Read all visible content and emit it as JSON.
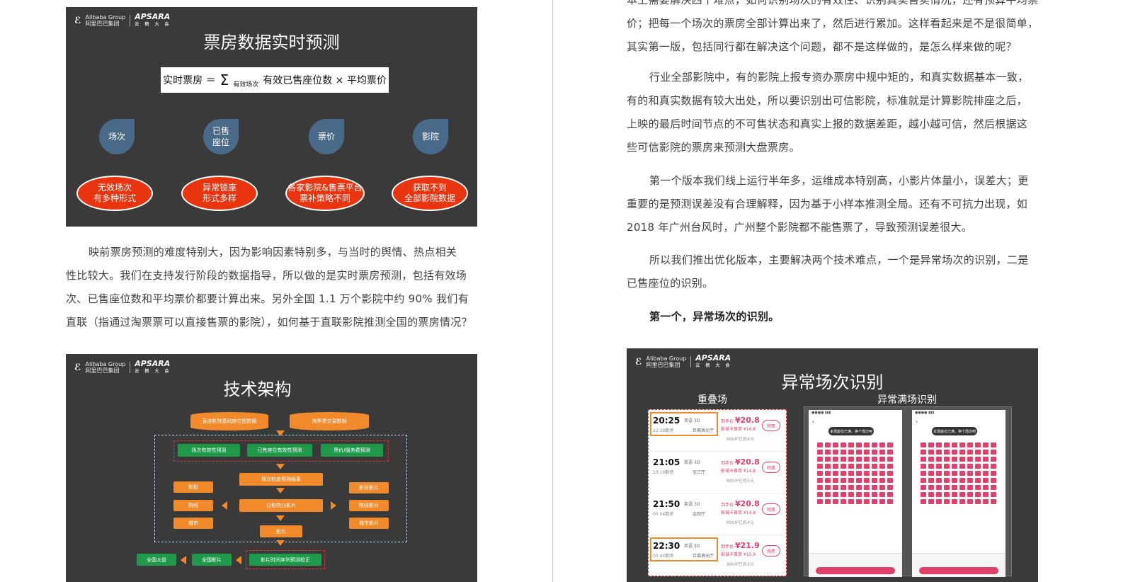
{
  "left_page": {
    "slide1": {
      "title": "票房数据实时预测",
      "formula_left": "实时票房 ＝",
      "formula_sigma": "Σ",
      "formula_sub": "有效场次",
      "formula_right": "有效已售座位数 × 平均票价",
      "factors": [
        "场次",
        "已售座位",
        "票价",
        "影院"
      ],
      "factor_line2": [
        "",
        "",
        "",
        ""
      ],
      "problems": [
        {
          "l1": "无效场次",
          "l2": "有多种形式"
        },
        {
          "l1": "异常锁座",
          "l2": "形式多样"
        },
        {
          "l1": "各家影院&售票平台",
          "l2": "票补策略不同"
        },
        {
          "l1": "获取不到",
          "l2": "全部影院数据"
        }
      ]
    },
    "paragraph1": [
      "映前票房预测的难度特别大，因为影响因素特别多，与当时的舆情、热点相关",
      "性比较大。我们在支持发行阶段的数据指导，所以做的是实时票房预测，包括有效场",
      "次、已售座位数和平均票价都要计算出来。另外全国 1.1 万个影院中约 90% 我们有",
      "直联（指通过淘票票可以直接售票的影院），如何基于直联影院推测全国的票房情况？"
    ],
    "slide2": {
      "title": "技术架构",
      "db1": "直连影院基础座位图数据",
      "db2": "淘票票交易数据",
      "row1": [
        "场次有效性预测",
        "已售座位有效性预测",
        "票价/服务费预测"
      ],
      "merge": "场次粒度预测结果",
      "left_col": [
        "影投",
        "院线",
        "城市"
      ],
      "center": "分影院分影片",
      "right_col": [
        "影投影片",
        "院线影片",
        "城市影片"
      ],
      "film": "影片",
      "bottom": [
        "全国大盘",
        "全国影片",
        "影片时间序列预测校正"
      ]
    }
  },
  "logo": {
    "alibaba": "Alibaba Group",
    "alibaba_cn": "阿里巴巴集团",
    "apsara": "APSARA",
    "apsara_cn": "云 栖 大 会"
  },
  "right_page": {
    "paragraph0": [
      "本上需要解决四个难点，如何识别场次的有效性、识别真实售卖情况，还有预算平均票",
      "价；把每一个场次的票房全部计算出来了，然后进行累加。这样看起来是不是很简单，",
      "其实第一版，包括同行都在解决这个问题，都不是这样做的，是怎么样来做的呢？"
    ],
    "paragraph1": [
      "行业全部影院中，有的影院上报专资办票房中规中矩的，和真实数据基本一致，",
      "有的和真实数据有较大出处，所以要识别出可信影院，标准就是计算影院排座之后，",
      "上映的最后时间节点的不可售状态和真实上报的数据差距，越小越可信，然后根据这",
      "些可信影院的票房来预测大盘票房。"
    ],
    "paragraph2": [
      "第一个版本我们线上运行半年多，运维成本特别高，小影片体量小，误差大；更",
      "重要的是预测误差没有合理解释，因为基于小样本推测全局。还有不可抗力出现，如",
      "2018 年广州台风时，广州整个影院都不能售票了，导致预测误差很大。"
    ],
    "paragraph3": [
      "所以我们推出优化版本，主要解决两个技术难点，一个是异常场次的识别，二是",
      "已售座位的识别。"
    ],
    "heading": "第一个，异常场次的识别。",
    "slide3": {
      "title": "异常场次识别",
      "label_left": "重叠场",
      "label_right": "异常满场识别",
      "tickets": [
        {
          "time": "20:25",
          "end": "22:39散场",
          "lang": "英语 3D",
          "hall": "巨幕激光厅",
          "price_label": "到手价",
          "price": "¥20.8",
          "card": "影城卡首单 ¥14.8",
          "vip": "88VIP已抵4元",
          "btn": "特惠"
        },
        {
          "time": "21:05",
          "end": "23:19散场",
          "lang": "英语 3D",
          "hall": "宝三厅",
          "price_label": "到手价",
          "price": "¥20.8",
          "card": "影城卡首单 ¥14.8",
          "vip": "88VIP已抵4元",
          "btn": "特惠"
        },
        {
          "time": "21:50",
          "end": "00:04散场",
          "lang": "英语 3D",
          "hall": "金四厅",
          "price_label": "到手价",
          "price": "¥20.8",
          "card": "影城卡首单 ¥14.8",
          "vip": "88VIP已抵4元",
          "btn": "特惠"
        },
        {
          "time": "22:30",
          "end": "00:44散场",
          "lang": "英语 3D",
          "hall": "巨幕激光厅",
          "price_label": "到手价",
          "price": "¥21.9",
          "card": "影城卡首单 ¥15.9",
          "vip": "88VIP已抵4元",
          "btn": "购票"
        }
      ],
      "phone_tip": "本场座位已满，换个场次吧"
    }
  }
}
